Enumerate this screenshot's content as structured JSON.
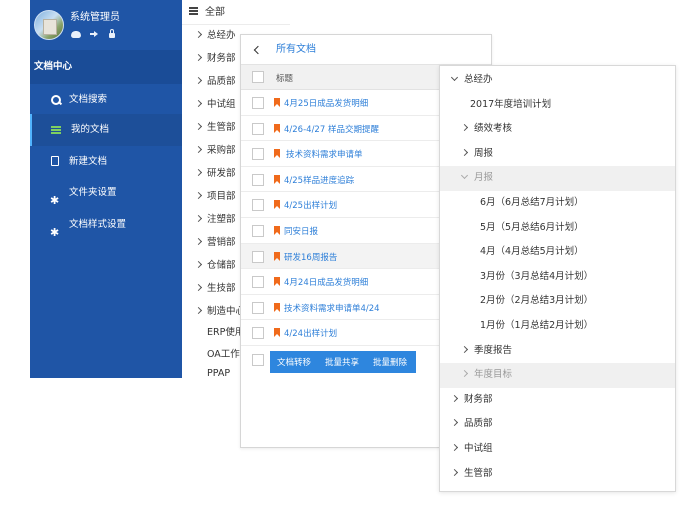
{
  "sidebar": {
    "username": "系统管理员",
    "user_icons": [
      "cloud-icon",
      "sign-out-icon",
      "lock-icon"
    ],
    "section_title": "文档中心",
    "items": [
      {
        "label": "文档搜索",
        "icon": "search-icon"
      },
      {
        "label": "我的文档",
        "icon": "list-icon",
        "active": true
      },
      {
        "label": "新建文档",
        "icon": "file-icon"
      },
      {
        "label": "文件夹设置",
        "icon": "gear-icon"
      },
      {
        "label": "文档样式设置",
        "icon": "gear-icon"
      }
    ],
    "accent": "#1f55a6"
  },
  "dept_panel": {
    "header": "全部",
    "items": [
      "总经办",
      "财务部",
      "品质部",
      "中试组",
      "生管部",
      "采购部",
      "研发部",
      "项目部",
      "注塑部",
      "营销部",
      "仓储部",
      "生技部",
      "制造中心"
    ],
    "plain_items": [
      "ERP使用",
      "OA工作",
      "PPAP"
    ]
  },
  "doc_panel": {
    "title": "所有文档",
    "column_title": "标题",
    "rows": [
      "4月25日成品发货明细",
      "4/26-4/27 样品交期提醒",
      "技术资料需求申请单",
      "4/25样品进度追踪",
      "4/25出样计划",
      "同安日报",
      "研发16周报告",
      "4月24日成品发货明细",
      "技术资料需求申请单4/24",
      "4/24出样计划"
    ],
    "actions": [
      "文档转移",
      "批量共享",
      "批量删除"
    ],
    "link_color": "#2e7fd8",
    "flag_color": "#f06a1b"
  },
  "tree_panel": {
    "nodes": [
      {
        "label": "总经办",
        "level": 0,
        "expanded": true
      },
      {
        "label": "2017年度培训计划",
        "level": 1,
        "leaf": true
      },
      {
        "label": "绩效考核",
        "level": 1
      },
      {
        "label": "周报",
        "level": 1
      },
      {
        "label": "月报",
        "level": 1,
        "expanded": true,
        "muted": true
      },
      {
        "label": "6月（6月总结7月计划）",
        "level": 2,
        "leaf": true
      },
      {
        "label": "5月（5月总结6月计划）",
        "level": 2,
        "leaf": true
      },
      {
        "label": "4月（4月总结5月计划）",
        "level": 2,
        "leaf": true
      },
      {
        "label": "3月份（3月总结4月计划）",
        "level": 2,
        "leaf": true
      },
      {
        "label": "2月份（2月总结3月计划）",
        "level": 2,
        "leaf": true
      },
      {
        "label": "1月份（1月总结2月计划）",
        "level": 2,
        "leaf": true
      },
      {
        "label": "季度报告",
        "level": 1
      },
      {
        "label": "年度目标",
        "level": 1,
        "muted": true
      },
      {
        "label": "财务部",
        "level": 0
      },
      {
        "label": "品质部",
        "level": 0
      },
      {
        "label": "中试组",
        "level": 0
      },
      {
        "label": "生管部",
        "level": 0
      }
    ]
  }
}
